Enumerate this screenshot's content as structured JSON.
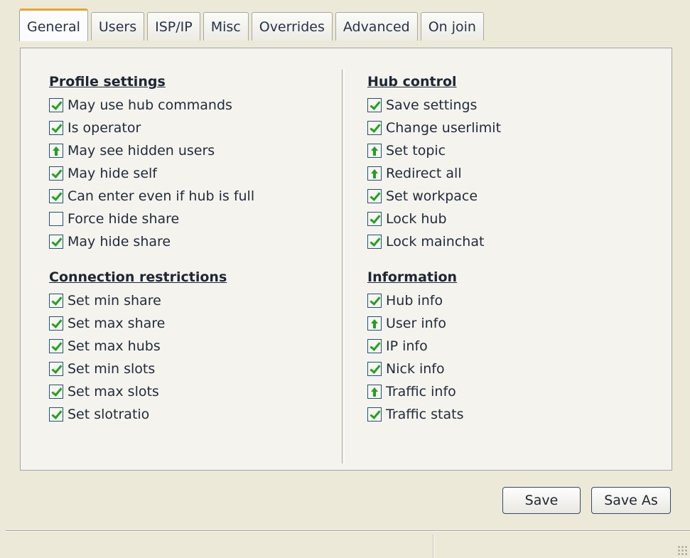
{
  "tabs": [
    {
      "label": "General",
      "active": true
    },
    {
      "label": "Users"
    },
    {
      "label": "ISP/IP"
    },
    {
      "label": "Misc"
    },
    {
      "label": "Overrides"
    },
    {
      "label": "Advanced"
    },
    {
      "label": "On join"
    }
  ],
  "left": {
    "profile": {
      "title": "Profile settings",
      "items": [
        {
          "label": "May use hub commands",
          "state": "checked"
        },
        {
          "label": "Is operator",
          "state": "checked"
        },
        {
          "label": "May see hidden users",
          "state": "partial"
        },
        {
          "label": "May hide self",
          "state": "checked"
        },
        {
          "label": "Can enter even if hub is full",
          "state": "checked"
        },
        {
          "label": "Force hide share",
          "state": "unchecked"
        },
        {
          "label": "May hide share",
          "state": "checked"
        }
      ]
    },
    "connection": {
      "title": "Connection restrictions",
      "items": [
        {
          "label": "Set min share",
          "state": "checked"
        },
        {
          "label": "Set max share",
          "state": "checked"
        },
        {
          "label": "Set max hubs",
          "state": "checked"
        },
        {
          "label": "Set min slots",
          "state": "checked"
        },
        {
          "label": "Set max slots",
          "state": "checked"
        },
        {
          "label": "Set slotratio",
          "state": "checked"
        }
      ]
    }
  },
  "right": {
    "hub": {
      "title": "Hub control",
      "items": [
        {
          "label": "Save settings",
          "state": "checked"
        },
        {
          "label": "Change userlimit",
          "state": "checked"
        },
        {
          "label": "Set topic",
          "state": "partial"
        },
        {
          "label": "Redirect all",
          "state": "partial"
        },
        {
          "label": "Set workpace",
          "state": "checked"
        },
        {
          "label": "Lock hub",
          "state": "checked"
        },
        {
          "label": "Lock mainchat",
          "state": "checked"
        }
      ]
    },
    "info": {
      "title": "Information",
      "items": [
        {
          "label": "Hub info",
          "state": "checked"
        },
        {
          "label": "User info",
          "state": "partial"
        },
        {
          "label": "IP info",
          "state": "checked"
        },
        {
          "label": "Nick info",
          "state": "checked"
        },
        {
          "label": "Traffic info",
          "state": "partial"
        },
        {
          "label": "Traffic stats",
          "state": "checked"
        }
      ]
    }
  },
  "buttons": {
    "save": "Save",
    "save_as": "Save As"
  },
  "colors": {
    "check": "#21a121",
    "active_tab": "#e8a335",
    "background": "#ece9d8"
  }
}
